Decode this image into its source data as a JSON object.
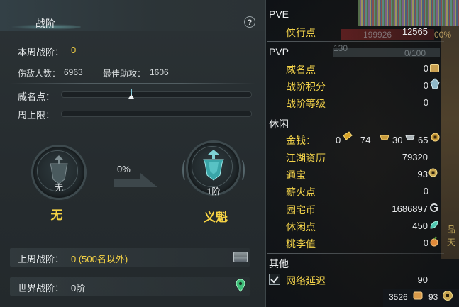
{
  "left_panel": {
    "title": "战阶",
    "help_label": "?",
    "weekly_rank_label": "本周战阶：",
    "weekly_rank_value": "0",
    "kills_label": "伤敌人数：",
    "kills_value": "6963",
    "best_assist_label": "最佳助攻：",
    "best_assist_value": "1606",
    "fame_points_label": "威名点：",
    "fame_points_level": 0.37,
    "weekly_cap_label": "周上限：",
    "weekly_cap_level": 0,
    "current_rank": {
      "tier": "无",
      "name": "无"
    },
    "progress_percent": "0%",
    "next_rank": {
      "tier": "1阶",
      "name": "义魁"
    },
    "last_week_label": "上周战阶：",
    "last_week_value": "0 (500名以外)",
    "world_rank_label": "世界战阶：",
    "world_rank_value": "0阶"
  },
  "right_panel": {
    "pve": {
      "header": "PVE",
      "rows": [
        {
          "label": "侠行点",
          "value": "12565"
        }
      ]
    },
    "pvp": {
      "header": "PVP",
      "rows": [
        {
          "label": "威名点",
          "value": "0"
        },
        {
          "label": "战阶积分",
          "value": "0"
        },
        {
          "label": "战阶等级",
          "value": "0"
        }
      ]
    },
    "leisure": {
      "header": "休闲",
      "money_label": "金钱：",
      "money_gold": "0",
      "money_silver": "74",
      "money_copper_a": "30",
      "money_copper_b": "65",
      "rows": [
        {
          "label": "江湖资历",
          "value": "79320"
        },
        {
          "label": "通宝",
          "value": "93"
        },
        {
          "label": "薪火点",
          "value": "0"
        },
        {
          "label": "园宅币",
          "value": "1686897"
        },
        {
          "label": "休闲点",
          "value": "450"
        },
        {
          "label": "桃李值",
          "value": "0"
        }
      ]
    },
    "other": {
      "header": "其他",
      "network_label": "网络延迟",
      "network_value": "90",
      "network_checked": true
    }
  },
  "background": {
    "hp_text": "199926",
    "pct_text": "00%",
    "level_text": "130",
    "mp_text": "0/100",
    "side_text_1": "品",
    "side_text_2": "天",
    "bottom_left_value": "3526",
    "bottom_right_value": "93"
  },
  "colors": {
    "accent_yellow": "#f5d244",
    "label_gold": "#f2d24a",
    "panel_bg": "#2b3235"
  }
}
